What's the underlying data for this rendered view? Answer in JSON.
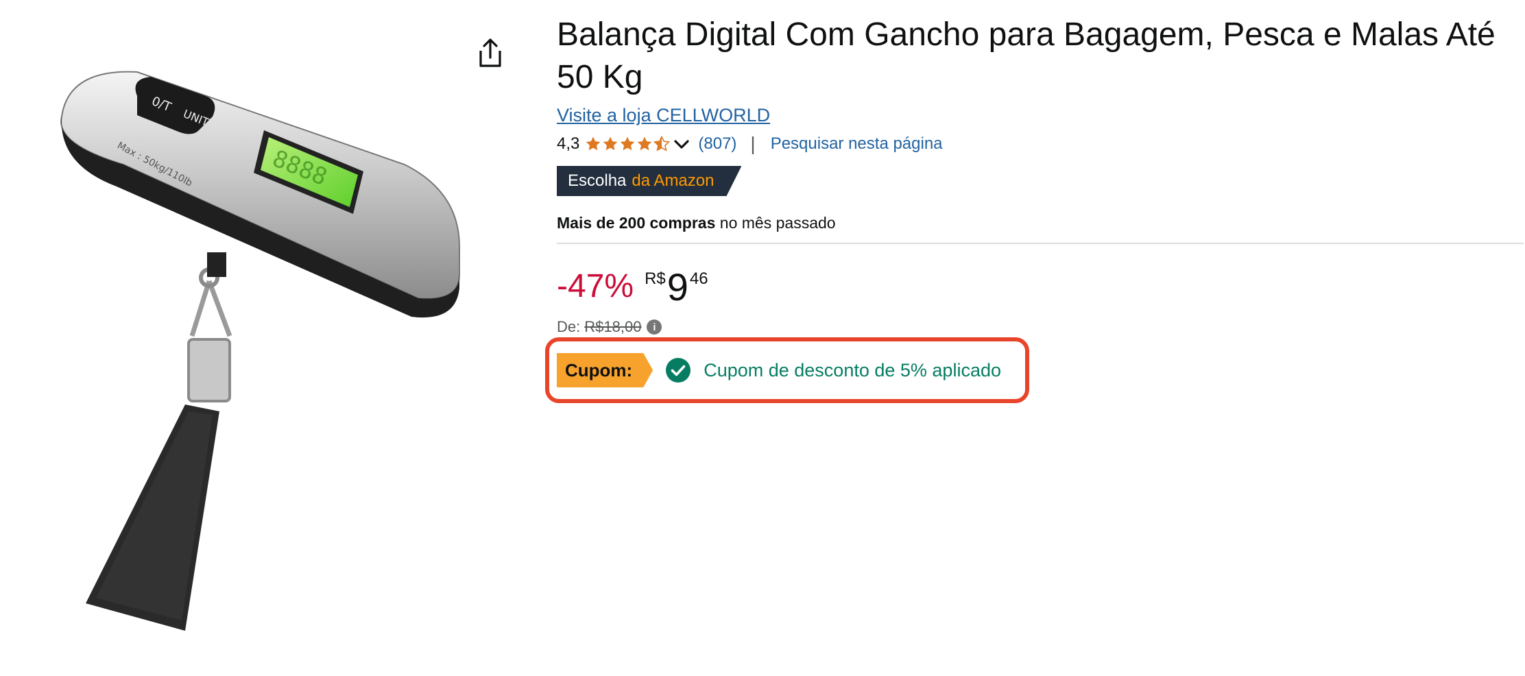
{
  "product": {
    "title": "Balança Digital Com Gancho para Bagagem, Pesca e Malas Até 50 Kg",
    "store_link": "Visite a loja CELLWORLD",
    "rating_value": "4,3",
    "rating_stars": 4.3,
    "review_count": "(807)",
    "separator": "|",
    "search_page": "Pesquisar nesta página",
    "image_labels": {
      "button_tare": "0/T",
      "button_unit": "UNIT",
      "max_text": "Max : 50kg/110lb"
    }
  },
  "badge": {
    "part1": "Escolha",
    "part2": "da Amazon"
  },
  "purchases": {
    "bold": "Mais de 200 compras",
    "rest": "no mês passado"
  },
  "price": {
    "discount": "-47%",
    "currency": "R$",
    "whole": "9",
    "fraction": "46",
    "list_label": "De:",
    "list_price": "R$18,00",
    "info_icon": "i"
  },
  "coupon": {
    "tag": "Cupom:",
    "text": "Cupom de desconto de 5% aplicado"
  },
  "colors": {
    "link": "#2162a1",
    "discount_red": "#cc0c39",
    "star_orange": "#de7921",
    "badge_dark": "#232f3e",
    "badge_orange": "#ff9900",
    "coupon_tag": "#f7a22d",
    "coupon_green": "#067d62",
    "highlight_red": "#e8442a"
  },
  "icons": {
    "share": "share-icon",
    "star": "star-icon",
    "chevron": "chevron-down-icon",
    "check": "check-circle-icon",
    "info": "info-icon"
  }
}
